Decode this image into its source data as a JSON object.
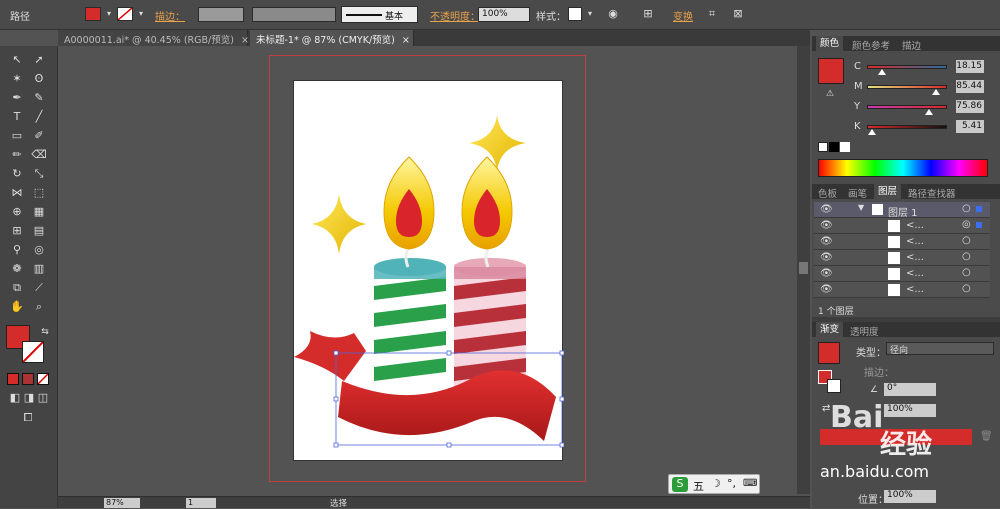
{
  "control_bar": {
    "object_type": "路径",
    "stroke_label": "描边：",
    "stroke_profile": "基本",
    "opacity_label": "不透明度：",
    "opacity_value": "100%",
    "style_label": "样式：",
    "transform_label": "变换",
    "fill_color": "#d42b2b"
  },
  "tabs": [
    {
      "label": "A0000011.ai* @ 40.45% (RGB/预览)",
      "close": "×"
    },
    {
      "label": "未标题-1* @ 87% (CMYK/预览)",
      "close": "×"
    }
  ],
  "color_panel": {
    "tabs": [
      "颜色",
      "颜色参考",
      "描边"
    ],
    "swatch": "#d42b2b",
    "channels": [
      {
        "name": "C",
        "value": "18.15",
        "fraction": 0.18
      },
      {
        "name": "M",
        "value": "85.44",
        "fraction": 0.85
      },
      {
        "name": "Y",
        "value": "75.86",
        "fraction": 0.76
      },
      {
        "name": "K",
        "value": "5.41",
        "fraction": 0.05
      }
    ]
  },
  "layers_panel": {
    "tabs": [
      "色板",
      "画笔",
      "图层",
      "路径查找器"
    ],
    "layer_name": "图层 1",
    "sublayer_labels": [
      "<...",
      "<...",
      "<...",
      "<...",
      "<..."
    ],
    "footer": "1 个图层"
  },
  "gradient_panel": {
    "tabs": [
      "渐变",
      "透明度"
    ],
    "type_label": "类型：",
    "type_value": "径向",
    "stroke_label": "描边：",
    "angle_value": "0°",
    "aspect_value": "100%",
    "position_label": "位置：",
    "position_value": "100%",
    "gradient_color": "#d42b2b"
  },
  "status_bar": {
    "zoom": "87%",
    "page": "1",
    "tool_label": "选择"
  },
  "ime": {
    "label": "五"
  },
  "watermark": {
    "text": "经验",
    "url": "an.baidu.com",
    "brand": "Bai"
  }
}
